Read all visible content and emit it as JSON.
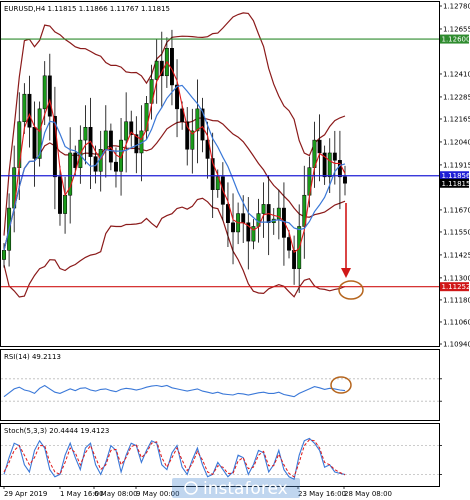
{
  "chart_data": {
    "type": "candlestick",
    "symbol_header": "EURUSD,H4  1.11815 1.11866 1.11767 1.11815",
    "price_axis": {
      "min": 1.1094,
      "max": 1.1278,
      "ticks": [
        "1.12780",
        "1.12655",
        "1.12410",
        "1.12285",
        "1.12165",
        "1.12040",
        "1.11915",
        "1.11670",
        "1.11550",
        "1.11425",
        "1.11300",
        "1.11180",
        "1.11060",
        "1.10940"
      ]
    },
    "levels": [
      {
        "name": "resistance",
        "value": 1.126,
        "label": "1.12600",
        "color": "#2e8b2e"
      },
      {
        "name": "current",
        "value": 1.11856,
        "label": "1.11856",
        "color": "#1f1fd6"
      },
      {
        "name": "last",
        "value": 1.11815,
        "label": "1.11815",
        "color": "#000000"
      },
      {
        "name": "support",
        "value": 1.11252,
        "label": "1.11252",
        "color": "#d01818"
      }
    ],
    "date_ticks": [
      "29 Apr 2019",
      "1 May 16:00",
      "6 May 08:00",
      "9 May 00:00",
      "23 May 16:00",
      "28 May 08:00"
    ],
    "close_series": [
      1.1145,
      1.1168,
      1.119,
      1.1215,
      1.123,
      1.1212,
      1.1195,
      1.1222,
      1.124,
      1.1218,
      1.1185,
      1.1165,
      1.1175,
      1.1198,
      1.119,
      1.1205,
      1.1212,
      1.1196,
      1.1188,
      1.12,
      1.121,
      1.1193,
      1.1188,
      1.1205,
      1.1215,
      1.1208,
      1.1198,
      1.121,
      1.1225,
      1.1238,
      1.1248,
      1.124,
      1.1255,
      1.1235,
      1.1222,
      1.1215,
      1.12,
      1.121,
      1.1222,
      1.1205,
      1.1195,
      1.1178,
      1.1185,
      1.117,
      1.116,
      1.1155,
      1.1165,
      1.116,
      1.115,
      1.1158,
      1.1165,
      1.117,
      1.116,
      1.1162,
      1.1168,
      1.1152,
      1.1145,
      1.1135,
      1.1158,
      1.1175,
      1.119,
      1.1205,
      1.1198,
      1.1185,
      1.1198,
      1.1194,
      1.1185,
      1.11815
    ],
    "rsi": {
      "label": "RSI(14) 49.2113",
      "min": 0,
      "max": 100,
      "values": [
        38,
        45,
        52,
        55,
        50,
        48,
        44,
        53,
        58,
        52,
        46,
        44,
        48,
        52,
        49,
        53,
        54,
        50,
        48,
        51,
        52,
        49,
        47,
        51,
        53,
        52,
        50,
        52,
        55,
        57,
        58,
        56,
        58,
        54,
        52,
        50,
        48,
        50,
        52,
        48,
        46,
        44,
        46,
        43,
        42,
        41,
        44,
        43,
        41,
        43,
        45,
        46,
        44,
        44,
        46,
        42,
        40,
        38,
        44,
        48,
        52,
        56,
        54,
        51,
        53,
        52,
        50,
        49
      ]
    },
    "stochastic": {
      "label": "Stoch(5,3,3) 20.4444 19.4123",
      "min": 0,
      "max": 100,
      "main": [
        20,
        55,
        85,
        80,
        40,
        25,
        70,
        90,
        75,
        30,
        15,
        20,
        60,
        85,
        55,
        30,
        75,
        85,
        40,
        20,
        45,
        80,
        70,
        25,
        60,
        85,
        80,
        45,
        70,
        90,
        85,
        40,
        30,
        65,
        80,
        35,
        20,
        50,
        75,
        40,
        15,
        20,
        45,
        30,
        15,
        25,
        60,
        55,
        20,
        40,
        70,
        65,
        25,
        40,
        70,
        30,
        15,
        10,
        60,
        90,
        95,
        85,
        70,
        35,
        40,
        25,
        22,
        20
      ],
      "signal": [
        25,
        45,
        70,
        80,
        60,
        40,
        55,
        80,
        80,
        45,
        25,
        20,
        45,
        75,
        65,
        40,
        65,
        80,
        55,
        30,
        40,
        70,
        72,
        40,
        55,
        78,
        82,
        55,
        65,
        85,
        88,
        55,
        35,
        55,
        75,
        50,
        28,
        42,
        68,
        50,
        25,
        20,
        38,
        35,
        22,
        22,
        48,
        55,
        32,
        35,
        60,
        68,
        38,
        38,
        62,
        40,
        22,
        15,
        45,
        80,
        92,
        90,
        75,
        45,
        40,
        30,
        24,
        19
      ]
    }
  },
  "watermark": "instaforex"
}
